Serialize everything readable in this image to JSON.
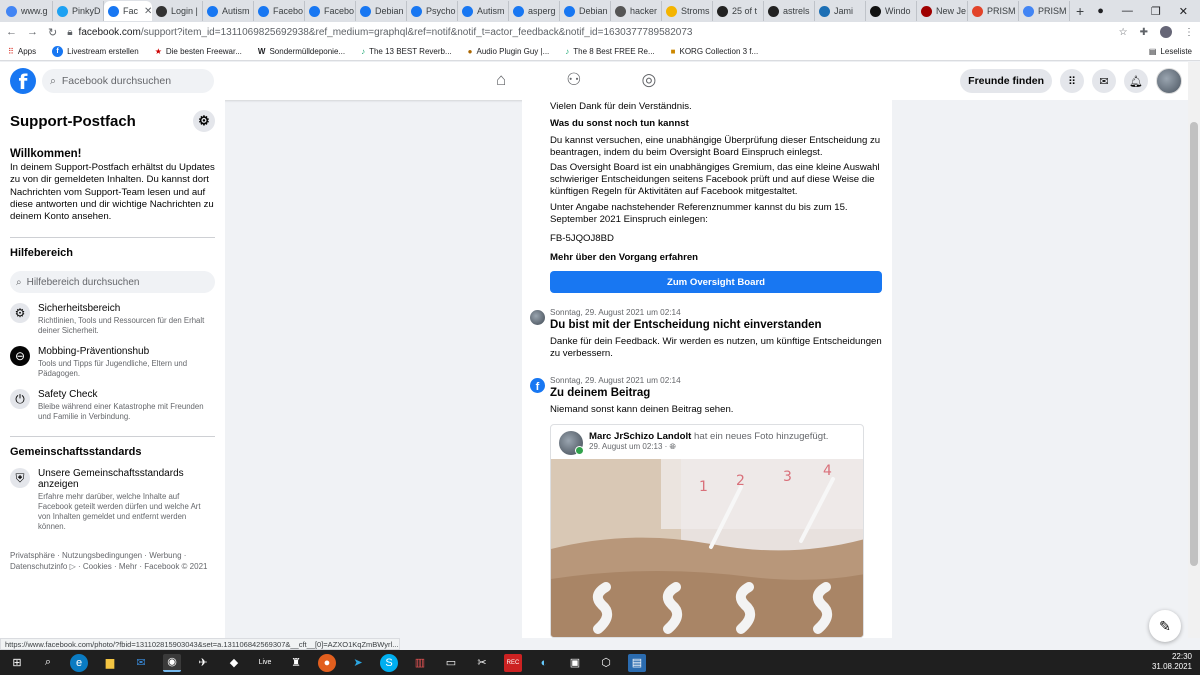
{
  "browser": {
    "tabs": [
      {
        "label": "www.g",
        "color": "#4285f4"
      },
      {
        "label": "PinkyD",
        "color": "#1da1f2"
      },
      {
        "label": "Fac",
        "color": "#1877f2",
        "active": true
      },
      {
        "label": "Login |",
        "color": "#333333"
      },
      {
        "label": "Autism",
        "color": "#1877f2"
      },
      {
        "label": "Facebo",
        "color": "#1877f2"
      },
      {
        "label": "Facebo",
        "color": "#1877f2"
      },
      {
        "label": "Debian",
        "color": "#1877f2"
      },
      {
        "label": "Psycho",
        "color": "#1877f2"
      },
      {
        "label": "Autism",
        "color": "#1877f2"
      },
      {
        "label": "asperg",
        "color": "#1877f2"
      },
      {
        "label": "Debian",
        "color": "#1877f2"
      },
      {
        "label": "hacker",
        "color": "#555555"
      },
      {
        "label": "Stroms",
        "color": "#f4b400"
      },
      {
        "label": "25 of t",
        "color": "#222222"
      },
      {
        "label": "astrels",
        "color": "#222222"
      },
      {
        "label": "Jami",
        "color": "#1c6fb5"
      },
      {
        "label": "Windo",
        "color": "#111111"
      },
      {
        "label": "New Je",
        "color": "#a00000"
      },
      {
        "label": "PRISM",
        "color": "#e24329"
      },
      {
        "label": "PRISM",
        "color": "#4285f4"
      }
    ],
    "url_host": "facebook.com",
    "url_rest": "/support?item_id=1311069825692938&ref_medium=graphql&ref=notif&notif_t=actor_feedback&notif_id=1630377789582073",
    "bookmarks": [
      "Apps",
      "Livestream erstellen",
      "Die besten Freewar...",
      "Sondermülldeponie...",
      "The 13 BEST Reverb...",
      "Audio Plugin Guy |...",
      "The 8 Best FREE Re...",
      "KORG Collection 3 f..."
    ],
    "reading_list": "Leseliste",
    "status_url": "https://www.facebook.com/photo/?fbid=131102815903043&set=a.131106842569307&__cft__[0]=AZXO1KqZmBWyrl..."
  },
  "fb": {
    "search_placeholder": "Facebook durchsuchen",
    "find_friends": "Freunde finden"
  },
  "sidebar": {
    "title": "Support-Postfach",
    "welcome_title": "Willkommen!",
    "welcome_text": "In deinem Support-Postfach erhältst du Updates zu von dir gemeldeten Inhalten. Du kannst dort Nachrichten vom Support-Team lesen und auf diese antworten und dir wichtige Nachrichten zu deinem Konto ansehen.",
    "help_title": "Hilfebereich",
    "help_search": "Hilfebereich durchsuchen",
    "items": [
      {
        "title": "Sicherheitsbereich",
        "desc": "Richtlinien, Tools und Ressourcen für den Erhalt deiner Sicherheit.",
        "icon": "⚙"
      },
      {
        "title": "Mobbing-Präventionshub",
        "desc": "Tools und Tipps für Jugendliche, Eltern und Pädagogen.",
        "icon": "⊖"
      },
      {
        "title": "Safety Check",
        "desc": "Bleibe während einer Katastrophe mit Freunden und Familie in Verbindung.",
        "icon": "⏻"
      }
    ],
    "standards_title": "Gemeinschaftsstandards",
    "standards_item_title": "Unsere Gemeinschaftsstandards anzeigen",
    "standards_item_desc": "Erfahre mehr darüber, welche Inhalte auf Facebook geteilt werden dürfen und welche Art von Inhalten gemeldet und entfernt werden können.",
    "footer": "Privatsphäre · Nutzungsbedingungen · Werbung · Datenschutzinfo ▷ · Cookies · Mehr · Facebook © 2021"
  },
  "content": {
    "thanks": "Vielen Dank für dein Verständnis.",
    "what_else": "Was du sonst noch tun kannst",
    "p1": "Du kannst versuchen, eine unabhängige Überprüfung dieser Entscheidung zu beantragen, indem du beim Oversight Board Einspruch einlegst.",
    "p2": "Das Oversight Board ist ein unabhängiges Gremium, das eine kleine Auswahl schwieriger Entscheidungen seitens Facebook prüft und auf diese Weise die künftigen Regeln für Aktivitäten auf Facebook mitgestaltet.",
    "p3": "Unter Angabe nachstehender Referenznummer kannst du bis zum 15. September 2021 Einspruch einlegen:",
    "ref": "FB-5JQOJ8BD",
    "more": "Mehr über den Vorgang erfahren",
    "oversight_btn": "Zum Oversight Board",
    "m2_time": "Sonntag, 29. August 2021 um 02:14",
    "m2_title": "Du bist mit der Entscheidung nicht einverstanden",
    "m2_text": "Danke für dein Feedback. Wir werden es nutzen, um künftige Entscheidungen zu verbessern.",
    "m3_time": "Sonntag, 29. August 2021 um 02:14",
    "m3_title": "Zu deinem Beitrag",
    "m3_text": "Niemand sonst kann deinen Beitrag sehen.",
    "post_author": "Marc JrSchizo Landolt",
    "post_action": " hat ein neues Foto hinzugefügt.",
    "post_time": "29. August um 02:13 · ",
    "photo_marks": [
      "1",
      "2",
      "3",
      "4"
    ]
  },
  "taskbar": {
    "time": "22:30",
    "date": "31.08.2021"
  }
}
